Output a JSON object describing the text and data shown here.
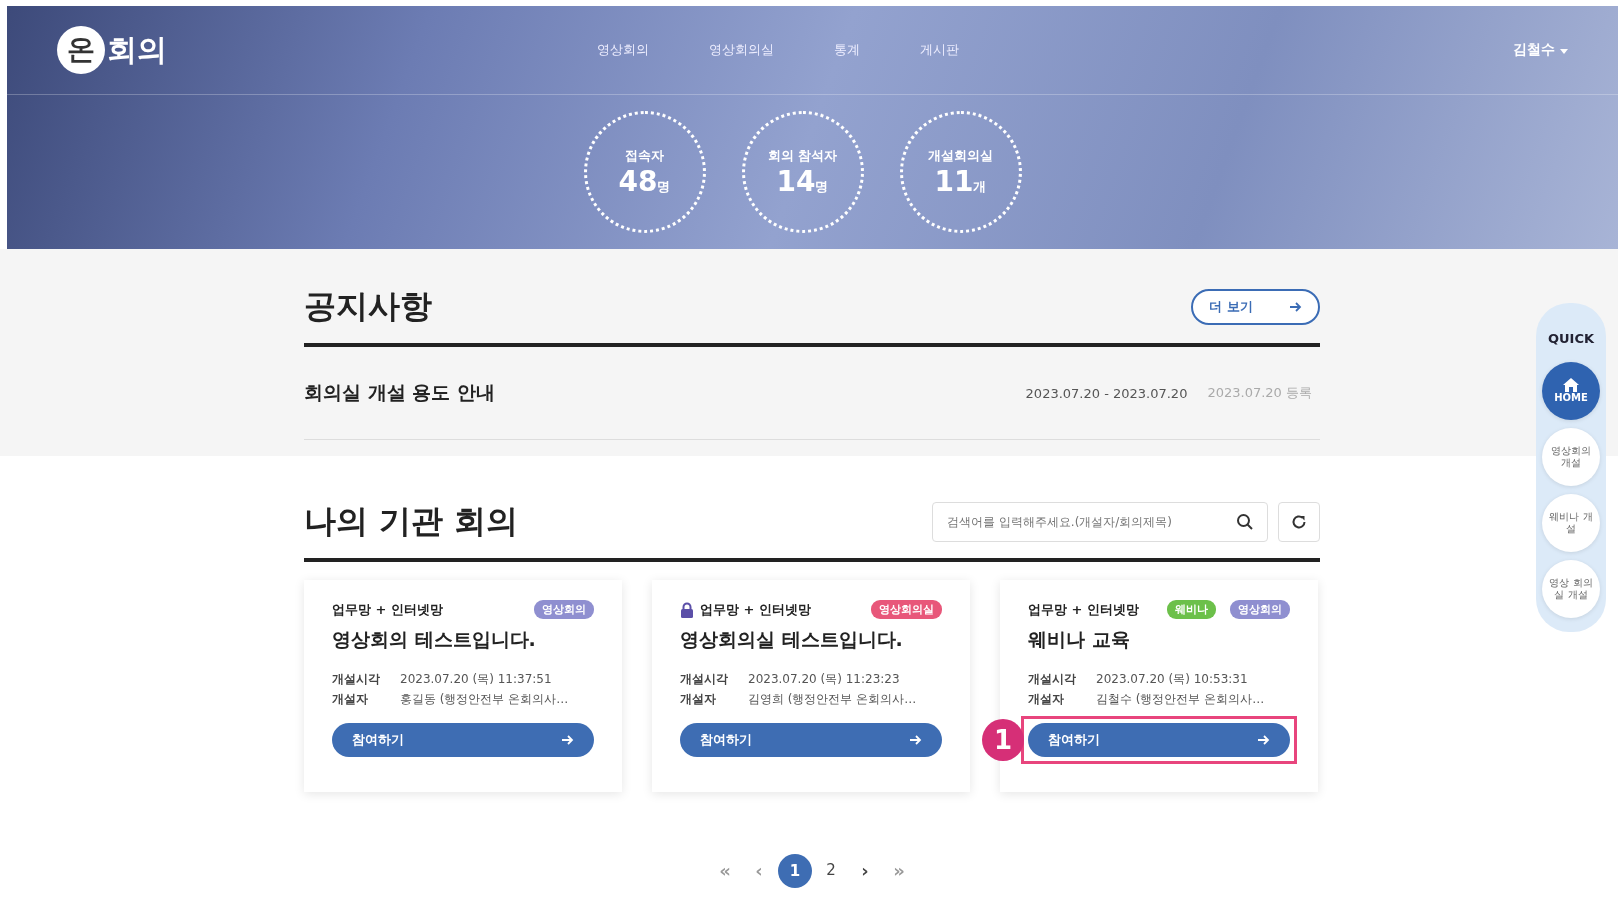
{
  "header": {
    "logo_mark": "온",
    "logo_text": "회의",
    "nav": [
      {
        "label": "영상회의",
        "selected": false
      },
      {
        "label": "영상회의실",
        "selected": false
      },
      {
        "label": "통계",
        "selected": false
      },
      {
        "label": "게시판",
        "selected": false
      }
    ],
    "user": "김철수"
  },
  "stats": [
    {
      "label": "접속자",
      "value": "48",
      "unit": "명"
    },
    {
      "label": "회의 참석자",
      "value": "14",
      "unit": "명"
    },
    {
      "label": "개설회의실",
      "value": "11",
      "unit": "개"
    }
  ],
  "notice": {
    "title": "공지사항",
    "more_button": "더 보기",
    "items": [
      {
        "title": "회의실 개설 용도 안내",
        "period": "2023.07.20 - 2023.07.20",
        "registered": "2023.07.20 등록"
      }
    ]
  },
  "meetings": {
    "title": "나의 기관 회의",
    "search": {
      "placeholder": "검색어를 입력해주세요.(개설자/회의제목)"
    },
    "cards": [
      {
        "network": "업무망 + 인터넷망",
        "locked": false,
        "badges": [
          {
            "label": "영상회의",
            "color": "#8f8fd0"
          }
        ],
        "title": "영상회의 테스트입니다.",
        "time_label": "개설시각",
        "time": "2023.07.20 (목) 11:37:51",
        "host_label": "개설자",
        "host": "홍길동 (행정안전부 온회의사…",
        "join_button": "참여하기"
      },
      {
        "network": "업무망 + 인터넷망",
        "locked": true,
        "badges": [
          {
            "label": "영상회의실",
            "color": "#e8577a"
          }
        ],
        "title": "영상회의실 테스트입니다.",
        "time_label": "개설시각",
        "time": "2023.07.20 (목) 11:23:23",
        "host_label": "개설자",
        "host": "김영희 (행정안전부 온회의사…",
        "join_button": "참여하기"
      },
      {
        "network": "업무망 + 인터넷망",
        "locked": false,
        "badges": [
          {
            "label": "웨비나",
            "color": "#6cc04a"
          },
          {
            "label": "영상회의",
            "color": "#8f8fd0"
          }
        ],
        "title": "웨비나 교육",
        "time_label": "개설시각",
        "time": "2023.07.20 (목) 10:53:31",
        "host_label": "개설자",
        "host": "김철수 (행정안전부 온회의사…",
        "join_button": "참여하기",
        "callout": "1"
      }
    ]
  },
  "pagination": [
    {
      "label": "«",
      "kind": "nav",
      "disabled": true,
      "selected": false
    },
    {
      "label": "‹",
      "kind": "nav",
      "disabled": true,
      "selected": false
    },
    {
      "label": "1",
      "kind": "page",
      "disabled": false,
      "selected": true
    },
    {
      "label": "2",
      "kind": "page",
      "disabled": false,
      "selected": false
    },
    {
      "label": "›",
      "kind": "nav",
      "disabled": false,
      "selected": false
    },
    {
      "label": "»",
      "kind": "nav",
      "disabled": true,
      "selected": false
    }
  ],
  "quick": {
    "title": "QUICK",
    "items": [
      {
        "label": "HOME",
        "kind": "home",
        "selected": true
      },
      {
        "label": "영상회의 개설",
        "kind": "text",
        "selected": false
      },
      {
        "label": "웨비나 개설",
        "kind": "text",
        "selected": false
      },
      {
        "label": "영상 회의실 개설",
        "kind": "text",
        "selected": false
      }
    ]
  }
}
